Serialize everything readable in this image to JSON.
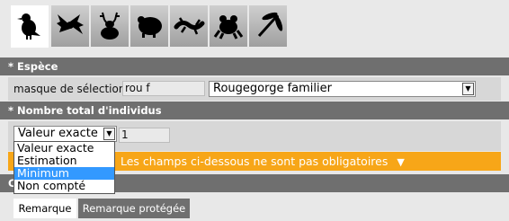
{
  "tabs": [
    {
      "name": "bird",
      "icon": "bird-icon"
    },
    {
      "name": "bat",
      "icon": "bat-icon"
    },
    {
      "name": "deer",
      "icon": "deer-icon"
    },
    {
      "name": "rodent",
      "icon": "rodent-icon"
    },
    {
      "name": "lizard",
      "icon": "lizard-icon"
    },
    {
      "name": "frog",
      "icon": "frog-icon"
    },
    {
      "name": "dragonfly",
      "icon": "dragonfly-icon"
    }
  ],
  "espece": {
    "header": "* Espèce",
    "mask_label": "masque de sélection",
    "mask_value": "rou f",
    "species_value": "Rougegorge familier"
  },
  "nombre": {
    "header": "* Nombre total d'individus",
    "type_value": "Valeur exacte",
    "count_value": "1",
    "options": [
      "Valeur exacte",
      "Estimation",
      "Minimum",
      "Non compté"
    ],
    "selected_option": "Minimum"
  },
  "optional_banner": "Les champs ci-dessous ne sont pas obligatoires",
  "comments": {
    "header_partial": "C",
    "tabs": [
      "Remarque",
      "Remarque protégée"
    ]
  },
  "colors": {
    "section_bg": "#6f6f6f",
    "row_bg": "#d7d7d7",
    "banner": "#f7a618",
    "highlight": "#3399ff"
  }
}
